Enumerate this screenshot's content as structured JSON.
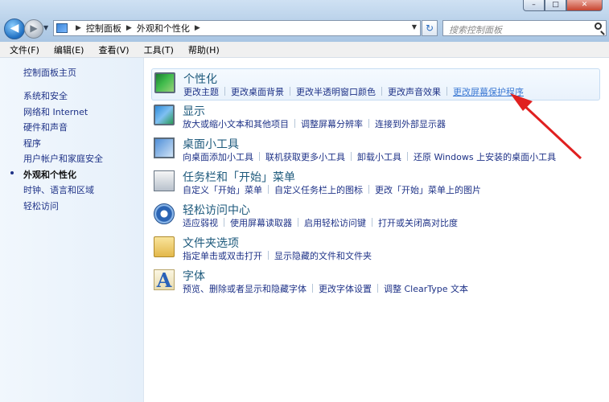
{
  "window": {
    "controls": {
      "minimize": "–",
      "maximize": "□",
      "close": "✕"
    }
  },
  "nav": {
    "back_icon": "back-arrow-icon",
    "forward_icon": "forward-arrow-icon",
    "breadcrumb": [
      "控制面板",
      "外观和个性化"
    ],
    "search_placeholder": "搜索控制面板"
  },
  "menu": [
    "文件(F)",
    "编辑(E)",
    "查看(V)",
    "工具(T)",
    "帮助(H)"
  ],
  "sidebar": {
    "home": "控制面板主页",
    "items": [
      {
        "label": "系统和安全",
        "active": false
      },
      {
        "label": "网络和 Internet",
        "active": false
      },
      {
        "label": "硬件和声音",
        "active": false
      },
      {
        "label": "程序",
        "active": false
      },
      {
        "label": "用户帐户和家庭安全",
        "active": false
      },
      {
        "label": "外观和个性化",
        "active": true
      },
      {
        "label": "时钟、语言和区域",
        "active": false
      },
      {
        "label": "轻松访问",
        "active": false
      }
    ]
  },
  "categories": [
    {
      "title": "个性化",
      "icon": "personalization-icon",
      "links": [
        "更改主题",
        "更改桌面背景",
        "更改半透明窗口颜色",
        "更改声音效果",
        "更改屏幕保护程序"
      ]
    },
    {
      "title": "显示",
      "icon": "display-icon",
      "links": [
        "放大或缩小文本和其他项目",
        "调整屏幕分辨率",
        "连接到外部显示器"
      ]
    },
    {
      "title": "桌面小工具",
      "icon": "gadgets-icon",
      "links": [
        "向桌面添加小工具",
        "联机获取更多小工具",
        "卸载小工具",
        "还原 Windows 上安装的桌面小工具"
      ]
    },
    {
      "title": "任务栏和「开始」菜单",
      "icon": "taskbar-icon",
      "links": [
        "自定义「开始」菜单",
        "自定义任务栏上的图标",
        "更改「开始」菜单上的图片"
      ]
    },
    {
      "title": "轻松访问中心",
      "icon": "ease-of-access-icon",
      "links": [
        "适应弱视",
        "使用屏幕读取器",
        "启用轻松访问键",
        "打开或关闭高对比度"
      ]
    },
    {
      "title": "文件夹选项",
      "icon": "folder-options-icon",
      "links": [
        "指定单击或双击打开",
        "显示隐藏的文件和文件夹"
      ]
    },
    {
      "title": "字体",
      "icon": "fonts-icon",
      "links": [
        "预览、删除或者显示和隐藏字体",
        "更改字体设置",
        "调整 ClearType 文本"
      ]
    }
  ],
  "annotation": {
    "color": "#e02020"
  }
}
